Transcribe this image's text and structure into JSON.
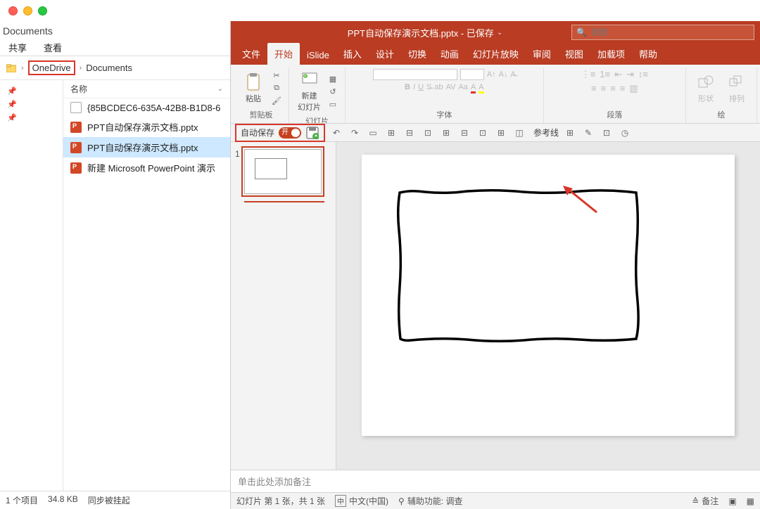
{
  "traffic": {
    "close": "close",
    "min": "minimize",
    "max": "maximize"
  },
  "explorer": {
    "title": "Documents",
    "tabs": {
      "share": "共享",
      "view": "查看"
    },
    "breadcrumb": {
      "onedrive": "OneDrive",
      "docs": "Documents"
    },
    "col_name": "名称",
    "files": [
      {
        "name": "{85BCDEC6-635A-42B8-B1D8-6",
        "type": "doc"
      },
      {
        "name": "PPT自动保存演示文档.pptx",
        "type": "ppt",
        "selected": true
      },
      {
        "name": "PPT自动保存演示文档.pptx",
        "type": "ppt"
      },
      {
        "name": "新建 Microsoft PowerPoint 演示",
        "type": "ppt"
      }
    ],
    "status": {
      "items": "1 个项目",
      "size": "34.8 KB",
      "sync": "同步被挂起"
    }
  },
  "ppt": {
    "title": "PPT自动保存演示文档.pptx - 已保存",
    "search_placeholder": "搜索",
    "tabs": [
      "文件",
      "开始",
      "iSlide",
      "插入",
      "设计",
      "切换",
      "动画",
      "幻灯片放映",
      "审阅",
      "视图",
      "加载项",
      "帮助"
    ],
    "active_tab": 1,
    "ribbon": {
      "clipboard": {
        "paste": "粘贴",
        "label": "剪贴板"
      },
      "slides": {
        "new": "新建\n幻灯片",
        "label": "幻灯片"
      },
      "font": {
        "label": "字体"
      },
      "para": {
        "label": "段落"
      },
      "shapes": {
        "shape": "形状",
        "arrange": "排列"
      },
      "drawing_label": "绘"
    },
    "qat": {
      "autosave": "自动保存",
      "toggle": "开",
      "guides": "参考线"
    },
    "thumb_num": "1",
    "notes_placeholder": "单击此处添加备注",
    "status": {
      "slide": "幻灯片 第 1 张，共 1 张",
      "lang_code": "中",
      "lang": "中文(中国)",
      "a11y_icon": "⚲",
      "a11y": "辅助功能: 调查",
      "notes_btn": "备注",
      "notes_icon": "≙",
      "views": "回"
    }
  }
}
